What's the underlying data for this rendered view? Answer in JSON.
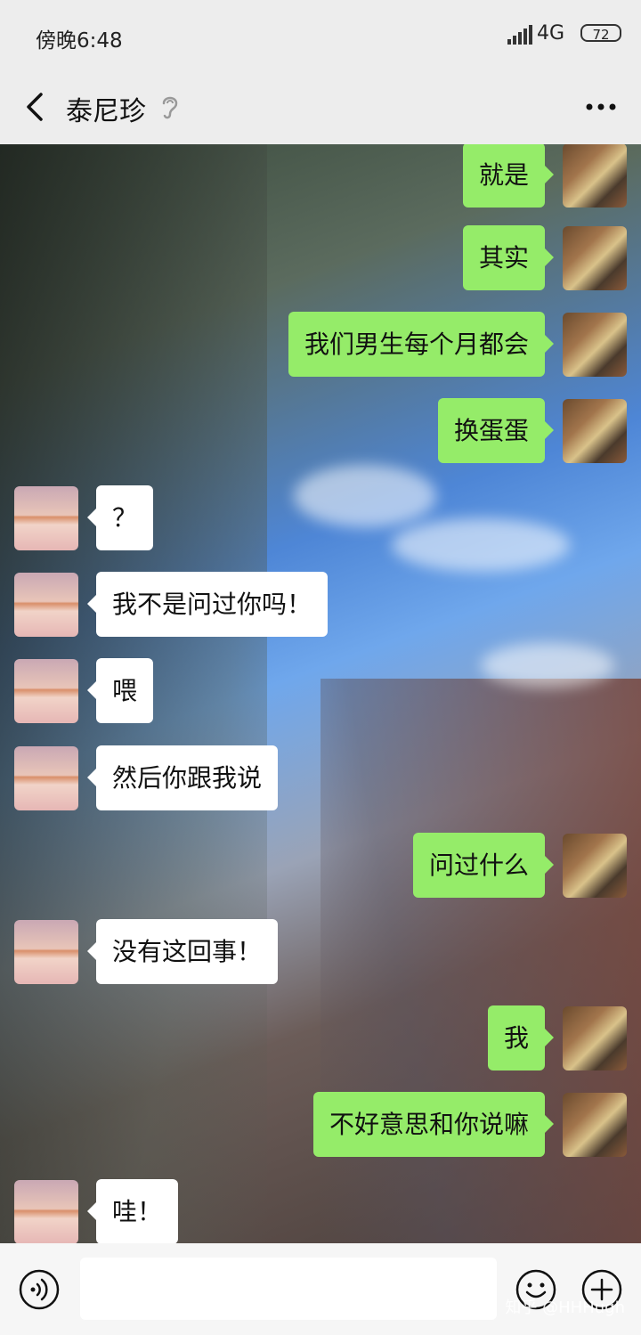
{
  "status_bar": {
    "time": "傍晚6:48",
    "network": "4G",
    "battery": "72"
  },
  "header": {
    "title": "泰尼珍"
  },
  "messages": [
    {
      "side": "right",
      "text": "就是"
    },
    {
      "side": "right",
      "text": "其实"
    },
    {
      "side": "right",
      "text": "我们男生每个月都会"
    },
    {
      "side": "right",
      "text": "换蛋蛋"
    },
    {
      "side": "left",
      "text": "？"
    },
    {
      "side": "left",
      "text": "我不是问过你吗！"
    },
    {
      "side": "left",
      "text": "喂"
    },
    {
      "side": "left",
      "text": "然后你跟我说"
    },
    {
      "side": "right",
      "text": "问过什么"
    },
    {
      "side": "left",
      "text": "没有这回事！"
    },
    {
      "side": "right",
      "text": "我"
    },
    {
      "side": "right",
      "text": "不好意思和你说嘛"
    },
    {
      "side": "left",
      "text": "哇！"
    }
  ],
  "watermark": "知乎 @HHHugh",
  "colors": {
    "right_bubble": "#95ec69",
    "left_bubble": "#ffffff",
    "bar_bg": "#ededed"
  }
}
